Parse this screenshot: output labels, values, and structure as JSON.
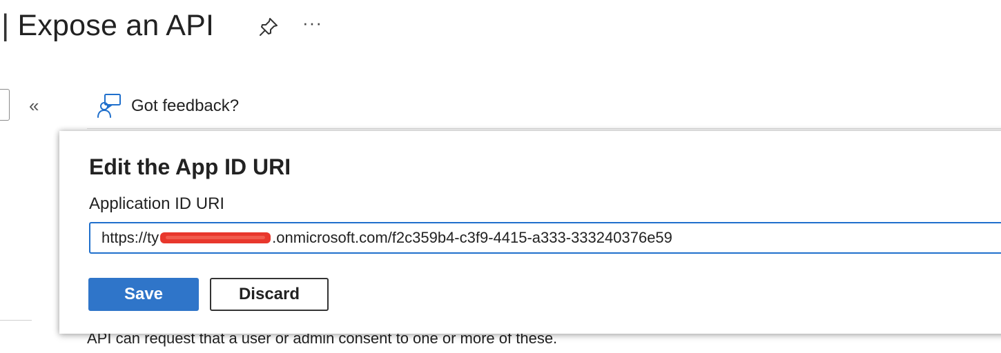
{
  "header": {
    "separator": "|",
    "title": "Expose an API",
    "more_label": "···",
    "pin_icon": "pin-icon",
    "more_icon": "more-icon"
  },
  "sidebar": {
    "collapse_label": "«",
    "collapse_icon": "double-chevron-left-icon"
  },
  "toolbar": {
    "feedback_label": "Got feedback?",
    "feedback_icon": "feedback-person-icon"
  },
  "background": {
    "text": "API can request that a user or admin consent to one or more of these."
  },
  "edit_panel": {
    "title": "Edit the App ID URI",
    "field_label": "Application ID URI",
    "uri_prefix": "https://",
    "uri_visible_char": "ty",
    "uri_suffix": ".onmicrosoft.com/f2c359b4-c3f9-4415-a333-333240376e59",
    "save_label": "Save",
    "discard_label": "Discard"
  },
  "colors": {
    "accent": "#2f75c9",
    "input_border": "#1f6fcc",
    "redaction": "#e8372c"
  }
}
